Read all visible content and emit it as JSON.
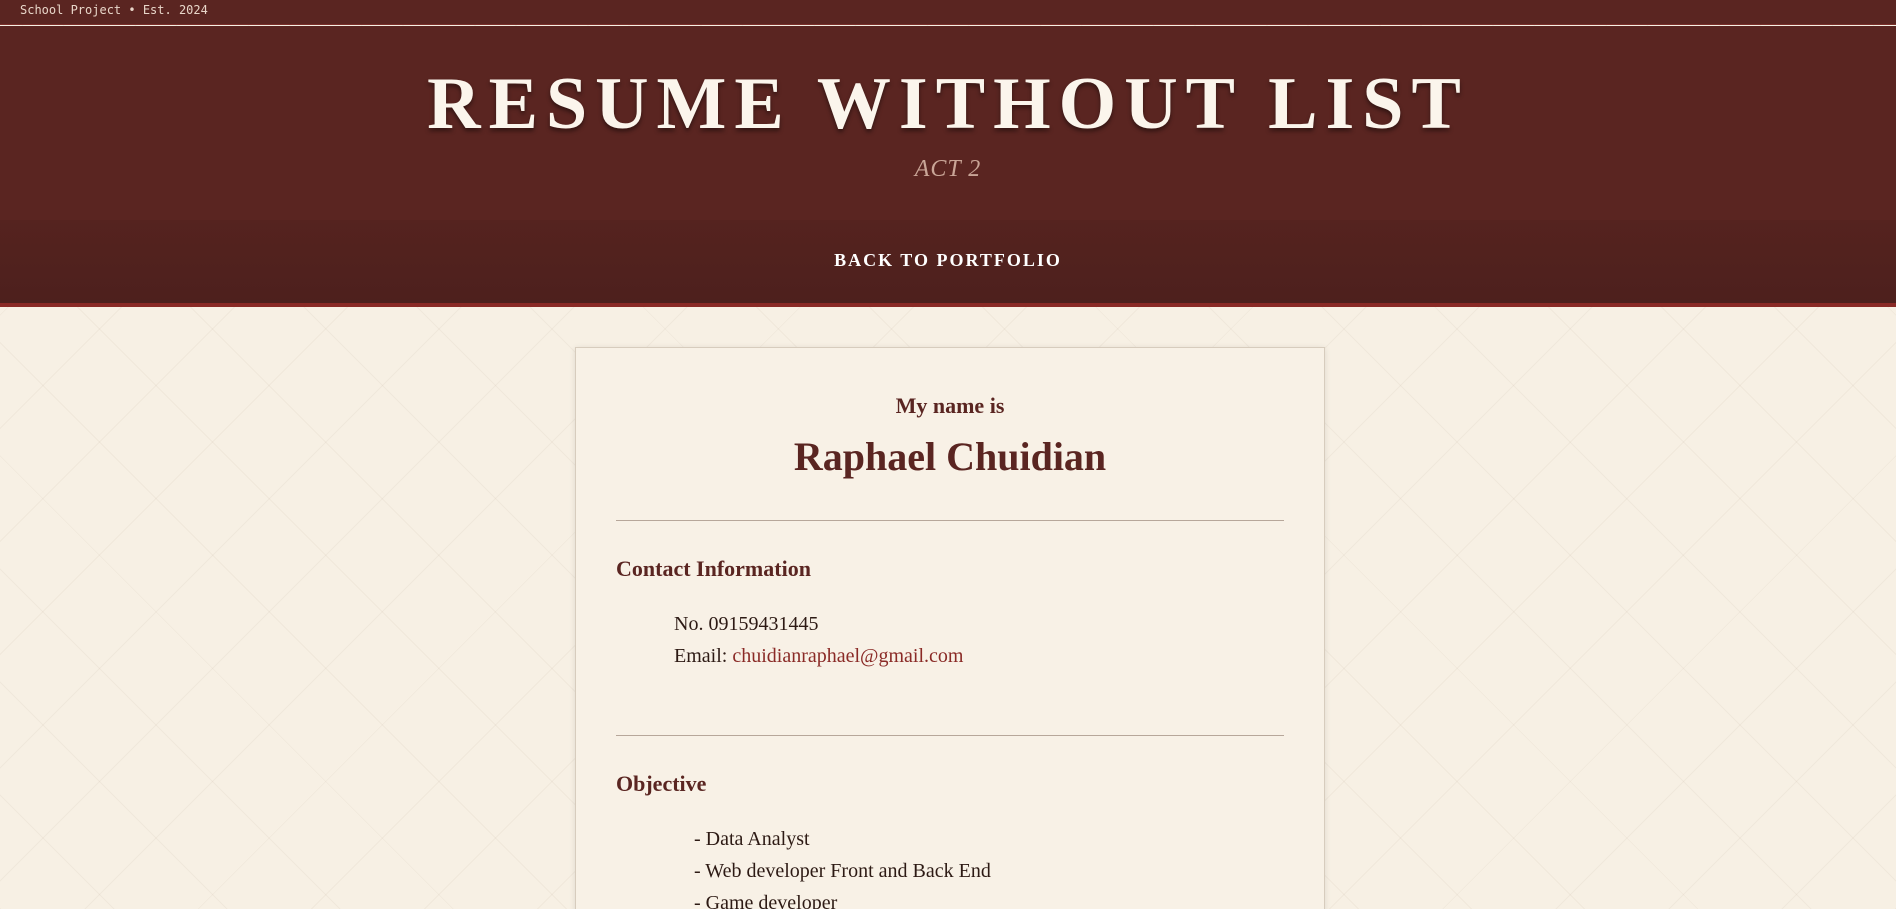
{
  "topbar": {
    "text": "School Project • Est. 2024"
  },
  "hero": {
    "title": "RESUME WITHOUT LIST",
    "subtitle": "ACT 2"
  },
  "nav": {
    "back_label": "BACK TO PORTFOLIO"
  },
  "resume": {
    "intro": "My name is",
    "name": "Raphael Chuidian",
    "contact": {
      "heading": "Contact Information",
      "phone": "No. 09159431445",
      "email_label": "Email:",
      "email": "chuidianraphael@gmail.com"
    },
    "objective": {
      "heading": "Objective",
      "items": [
        "- Data Analyst",
        "- Web developer Front and Back End",
        "- Game developer"
      ]
    }
  },
  "colors": {
    "header_bg": "#5a2521",
    "accent": "#8a2a26",
    "page_bg": "#f7f0e4"
  }
}
